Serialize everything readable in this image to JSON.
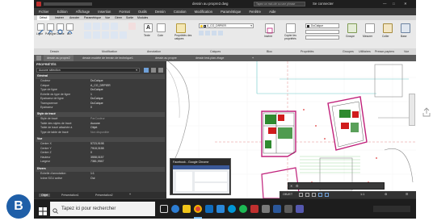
{
  "app": {
    "title": "dessin au propre2.dwg",
    "search_placeholder": "Tapez un mot-clé ou une phrase",
    "user_button": "Se connecter"
  },
  "menu": [
    "Fichier",
    "Edition",
    "Affichage",
    "Insertion",
    "Format",
    "Outils",
    "Dessin",
    "Cotation",
    "Modification",
    "Paramétrique",
    "Fenêtre",
    "Aide"
  ],
  "ribbon": {
    "tabs": [
      "Début",
      "Insérer",
      "Annoter",
      "Paramétrique",
      "Vue",
      "Gérer",
      "Sortie",
      "Modules"
    ],
    "draw_tools": [
      "Ligne",
      "Polyligne",
      "Cercle",
      "Arc"
    ],
    "annot_tools": [
      "Texte",
      "Cote"
    ],
    "layer_tools": [
      "Propriétés des calques"
    ],
    "block_tools": [
      "Insérer"
    ],
    "prop_tools": [
      "Copier les propriétés"
    ],
    "layer_name": "A_CO_DRPIER",
    "color_value": "DuCalque",
    "group_tools": [
      "Groupe"
    ],
    "utility_tools": [
      "Mesurer"
    ],
    "clipboard_tools": [
      "Coller"
    ],
    "view_tools": [
      "Base"
    ],
    "panel_labels": [
      "Dessin",
      "Modification",
      "Annotation",
      "Calques",
      "Bloc",
      "Propriétés",
      "Groupes",
      "Utilitaires",
      "Presse-papiers",
      "Vue"
    ]
  },
  "doc_tabs": [
    "dessin au propre2",
    "dessin modèle de terrain de technique1",
    "dessin au propre",
    "dessin test-plan-étage"
  ],
  "properties": {
    "title": "PROPRIÉTÉS",
    "selection": "Aucune sélection",
    "sections": [
      {
        "name": "Général",
        "rows": [
          {
            "name": "Couleur",
            "value": "DuCalque"
          },
          {
            "name": "Calque",
            "value": "A_CO_DRPIER"
          },
          {
            "name": "Type de ligne",
            "value": "DuCalque"
          },
          {
            "name": "Echelle du type de ligne",
            "value": "1"
          },
          {
            "name": "Epaisseur de ligne",
            "value": "DuCalque"
          },
          {
            "name": "Transparence",
            "value": "DuCalque"
          },
          {
            "name": "Epaisseur",
            "value": "0"
          }
        ]
      },
      {
        "name": "Style de tracé",
        "rows": [
          {
            "name": "Style de tracé",
            "value": "ParCouleur"
          },
          {
            "name": "Table des styles de tracé",
            "value": "Aucune"
          },
          {
            "name": "Table de tracé attachée à",
            "value": "Objet"
          },
          {
            "name": "Type de table de tracé",
            "value": "Non disponible"
          }
        ]
      },
      {
        "name": "Vue",
        "rows": [
          {
            "name": "Centre X",
            "value": "5723,9198"
          },
          {
            "name": "Centre Y",
            "value": "7918,3158"
          },
          {
            "name": "Centre Z",
            "value": "0"
          },
          {
            "name": "Hauteur",
            "value": "3558,0157"
          },
          {
            "name": "Largeur",
            "value": "7381,9947"
          }
        ]
      },
      {
        "name": "Divers",
        "rows": [
          {
            "name": "Echelle d'annotation",
            "value": "1:1"
          },
          {
            "name": "Icône SCU active",
            "value": "Oui"
          }
        ]
      }
    ]
  },
  "layout_tabs": [
    "Objet",
    "Présentation1",
    "Présentation2"
  ],
  "status": {
    "mode": "OBJET",
    "scale": "1:1"
  },
  "taskbar": {
    "search_placeholder": "Tapez ici pour rechercher",
    "preview_title": "Facebook - Google Chrome"
  },
  "avatar_letter": "B",
  "colors": {
    "accent_blue": "#1f5fa8",
    "magenta": "#c0207a",
    "taskbar": "#1d1d1d"
  }
}
